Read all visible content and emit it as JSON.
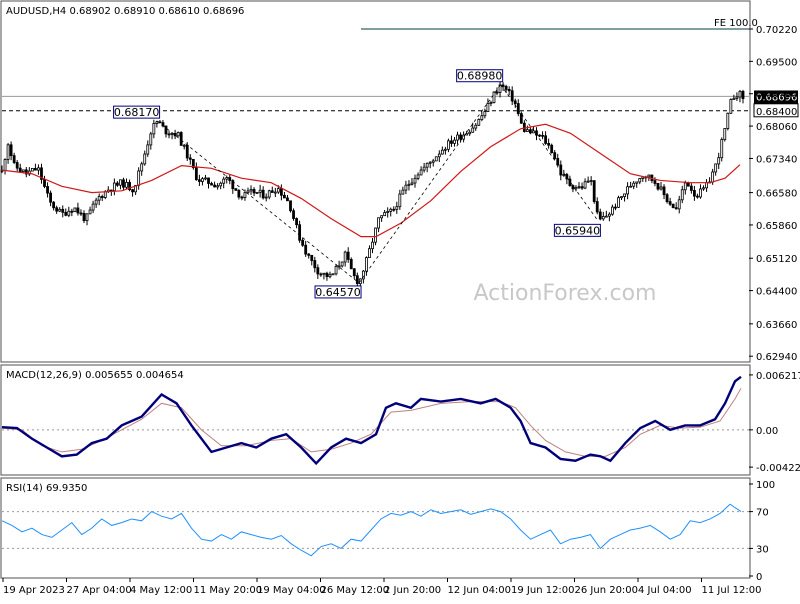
{
  "watermark": "ActionForex.com",
  "colors": {
    "candle": "#000000",
    "ma": "#d01818",
    "macd": "#00007a",
    "signal": "#c08080",
    "rsi": "#1e90ff",
    "annotation_border": "#000080",
    "current_price_box": "#000000",
    "fe_line": "#003c3c",
    "panel_border": "#505050"
  },
  "chart_data": [
    {
      "type": "candlestick",
      "title": "AUDUSD,H4  0.68902 0.68910 0.68610 0.68696",
      "y_ticks": [
        "0.70220",
        "0.69500",
        "0.68780",
        "0.68060",
        "0.67340",
        "0.66580",
        "0.65860",
        "0.65120",
        "0.64400",
        "0.63660",
        "0.62940"
      ],
      "x_ticks": [
        "19 Apr 2023",
        "27 Apr 04:00",
        "4 May 12:00",
        "11 May 20:00",
        "19 May 04:00",
        "26 May 12:00",
        "2 Jun 20:00",
        "12 Jun 04:00",
        "19 Jun 12:00",
        "26 Jun 20:00",
        "4 Jul 04:00",
        "11 Jul 12:00"
      ],
      "ylim": [
        0.629,
        0.7042
      ],
      "path_points": [
        [
          0,
          0.6705
        ],
        [
          6,
          0.677
        ],
        [
          12,
          0.6718
        ],
        [
          24,
          0.67
        ],
        [
          36,
          0.6712
        ],
        [
          48,
          0.6636
        ],
        [
          60,
          0.661
        ],
        [
          72,
          0.6625
        ],
        [
          84,
          0.6598
        ],
        [
          96,
          0.6645
        ],
        [
          108,
          0.6668
        ],
        [
          120,
          0.668
        ],
        [
          132,
          0.6665
        ],
        [
          144,
          0.6752
        ],
        [
          150,
          0.68
        ],
        [
          156,
          0.6817
        ],
        [
          164,
          0.6795
        ],
        [
          176,
          0.6788
        ],
        [
          186,
          0.674
        ],
        [
          196,
          0.6688
        ],
        [
          206,
          0.6682
        ],
        [
          216,
          0.6675
        ],
        [
          226,
          0.669
        ],
        [
          240,
          0.6648
        ],
        [
          252,
          0.666
        ],
        [
          264,
          0.6652
        ],
        [
          276,
          0.667
        ],
        [
          288,
          0.6635
        ],
        [
          298,
          0.656
        ],
        [
          306,
          0.652
        ],
        [
          318,
          0.648
        ],
        [
          330,
          0.647
        ],
        [
          344,
          0.652
        ],
        [
          352,
          0.6475
        ],
        [
          358,
          0.6457
        ],
        [
          366,
          0.651
        ],
        [
          378,
          0.66
        ],
        [
          392,
          0.6618
        ],
        [
          404,
          0.6668
        ],
        [
          416,
          0.67
        ],
        [
          428,
          0.6722
        ],
        [
          440,
          0.6752
        ],
        [
          452,
          0.6775
        ],
        [
          464,
          0.679
        ],
        [
          476,
          0.6812
        ],
        [
          486,
          0.6845
        ],
        [
          494,
          0.688
        ],
        [
          500,
          0.6898
        ],
        [
          506,
          0.6885
        ],
        [
          514,
          0.686
        ],
        [
          522,
          0.68
        ],
        [
          532,
          0.679
        ],
        [
          542,
          0.678
        ],
        [
          552,
          0.675
        ],
        [
          560,
          0.6702
        ],
        [
          570,
          0.6675
        ],
        [
          580,
          0.6668
        ],
        [
          590,
          0.669
        ],
        [
          598,
          0.6594
        ],
        [
          608,
          0.661
        ],
        [
          620,
          0.6645
        ],
        [
          632,
          0.668
        ],
        [
          644,
          0.67
        ],
        [
          656,
          0.668
        ],
        [
          666,
          0.6645
        ],
        [
          676,
          0.662
        ],
        [
          686,
          0.6685
        ],
        [
          696,
          0.665
        ],
        [
          706,
          0.667
        ],
        [
          716,
          0.672
        ],
        [
          724,
          0.679
        ],
        [
          732,
          0.687
        ],
        [
          738,
          0.688
        ],
        [
          743,
          0.68696
        ]
      ],
      "ma_points": [
        [
          0,
          0.6708
        ],
        [
          30,
          0.67
        ],
        [
          60,
          0.6672
        ],
        [
          90,
          0.6658
        ],
        [
          120,
          0.6662
        ],
        [
          150,
          0.6685
        ],
        [
          180,
          0.6718
        ],
        [
          210,
          0.6712
        ],
        [
          240,
          0.669
        ],
        [
          270,
          0.668
        ],
        [
          300,
          0.6645
        ],
        [
          330,
          0.66
        ],
        [
          360,
          0.656
        ],
        [
          375,
          0.656
        ],
        [
          400,
          0.659
        ],
        [
          430,
          0.664
        ],
        [
          460,
          0.6705
        ],
        [
          490,
          0.676
        ],
        [
          520,
          0.68
        ],
        [
          545,
          0.681
        ],
        [
          570,
          0.679
        ],
        [
          600,
          0.6745
        ],
        [
          630,
          0.67
        ],
        [
          660,
          0.6685
        ],
        [
          690,
          0.668
        ],
        [
          710,
          0.668
        ],
        [
          725,
          0.669
        ],
        [
          740,
          0.672
        ]
      ],
      "annotations": [
        {
          "label": "0.68170",
          "x": 156,
          "y": 0.6817
        },
        {
          "label": "0.64570",
          "x": 358,
          "y": 0.6457
        },
        {
          "label": "0.68980",
          "x": 500,
          "y": 0.6898
        },
        {
          "label": "0.65940",
          "x": 598,
          "y": 0.6594
        }
      ],
      "fe_label": "FE 100.0",
      "fe_level": 0.7022,
      "dashed_level": 0.684,
      "dashed_label": "0.68400",
      "current_price_label": "0.68696",
      "current_price": 0.68696,
      "horizontal_line_level": 0.6872
    },
    {
      "type": "line",
      "title": "MACD(12,26,9) 0.005655 0.004654",
      "y_ticks": [
        "0.006217",
        "0.00",
        "-0.004221"
      ],
      "ylim": [
        -0.005,
        0.007
      ],
      "series": [
        {
          "values": [
            [
              0,
              0.0003
            ],
            [
              15,
              0.0002
            ],
            [
              30,
              -0.001
            ],
            [
              45,
              -0.002
            ],
            [
              60,
              -0.003
            ],
            [
              75,
              -0.0028
            ],
            [
              90,
              -0.0015
            ],
            [
              105,
              -0.001
            ],
            [
              120,
              0.0005
            ],
            [
              140,
              0.0015
            ],
            [
              160,
              0.004
            ],
            [
              175,
              0.003
            ],
            [
              190,
              0.0005
            ],
            [
              200,
              -0.001
            ],
            [
              210,
              -0.0025
            ],
            [
              225,
              -0.002
            ],
            [
              240,
              -0.0015
            ],
            [
              255,
              -0.002
            ],
            [
              270,
              -0.001
            ],
            [
              285,
              -0.0005
            ],
            [
              300,
              -0.002
            ],
            [
              315,
              -0.0038
            ],
            [
              330,
              -0.002
            ],
            [
              345,
              -0.001
            ],
            [
              360,
              -0.0015
            ],
            [
              375,
              -0.0005
            ],
            [
              385,
              0.0025
            ],
            [
              395,
              0.003
            ],
            [
              410,
              0.0025
            ],
            [
              420,
              0.0035
            ],
            [
              440,
              0.0032
            ],
            [
              460,
              0.0035
            ],
            [
              480,
              0.003
            ],
            [
              495,
              0.0035
            ],
            [
              510,
              0.0025
            ],
            [
              520,
              0.001
            ],
            [
              530,
              -0.0015
            ],
            [
              545,
              -0.002
            ],
            [
              560,
              -0.0033
            ],
            [
              575,
              -0.0035
            ],
            [
              590,
              -0.0028
            ],
            [
              600,
              -0.003
            ],
            [
              610,
              -0.0035
            ],
            [
              625,
              -0.0015
            ],
            [
              640,
              0.0002
            ],
            [
              655,
              0.001
            ],
            [
              670,
              0.0
            ],
            [
              685,
              0.0005
            ],
            [
              700,
              0.0005
            ],
            [
              715,
              0.0012
            ],
            [
              725,
              0.003
            ],
            [
              735,
              0.0055
            ],
            [
              741,
              0.006
            ]
          ]
        },
        {
          "values": [
            [
              0,
              0.0002
            ],
            [
              20,
              0.0
            ],
            [
              40,
              -0.0018
            ],
            [
              60,
              -0.0025
            ],
            [
              80,
              -0.0022
            ],
            [
              100,
              -0.0012
            ],
            [
              120,
              0.0
            ],
            [
              140,
              0.0012
            ],
            [
              160,
              0.003
            ],
            [
              180,
              0.0025
            ],
            [
              200,
              0.0
            ],
            [
              220,
              -0.0018
            ],
            [
              245,
              -0.0018
            ],
            [
              270,
              -0.0012
            ],
            [
              290,
              -0.001
            ],
            [
              310,
              -0.0025
            ],
            [
              330,
              -0.0022
            ],
            [
              350,
              -0.0015
            ],
            [
              370,
              -0.0005
            ],
            [
              390,
              0.002
            ],
            [
              410,
              0.0022
            ],
            [
              440,
              0.003
            ],
            [
              470,
              0.0032
            ],
            [
              500,
              0.0032
            ],
            [
              515,
              0.0025
            ],
            [
              530,
              0.0005
            ],
            [
              545,
              -0.0012
            ],
            [
              565,
              -0.0025
            ],
            [
              585,
              -0.003
            ],
            [
              605,
              -0.003
            ],
            [
              625,
              -0.002
            ],
            [
              640,
              -0.0005
            ],
            [
              660,
              0.0005
            ],
            [
              680,
              0.0002
            ],
            [
              700,
              0.0003
            ],
            [
              720,
              0.001
            ],
            [
              735,
              0.0035
            ],
            [
              741,
              0.0047
            ]
          ]
        }
      ],
      "zero_level": 0.0
    },
    {
      "type": "line",
      "title": "RSI(14) 69.9350",
      "y_ticks": [
        "100",
        "70",
        "30",
        "0"
      ],
      "ylim": [
        0,
        100
      ],
      "levels": [
        70,
        30
      ],
      "series": [
        {
          "values": [
            [
              0,
              60
            ],
            [
              10,
              55
            ],
            [
              20,
              48
            ],
            [
              30,
              52
            ],
            [
              40,
              45
            ],
            [
              50,
              42
            ],
            [
              60,
              50
            ],
            [
              70,
              58
            ],
            [
              80,
              45
            ],
            [
              90,
              52
            ],
            [
              100,
              62
            ],
            [
              110,
              55
            ],
            [
              120,
              58
            ],
            [
              130,
              62
            ],
            [
              140,
              60
            ],
            [
              150,
              70
            ],
            [
              160,
              65
            ],
            [
              170,
              62
            ],
            [
              180,
              68
            ],
            [
              190,
              52
            ],
            [
              200,
              40
            ],
            [
              210,
              38
            ],
            [
              220,
              45
            ],
            [
              230,
              40
            ],
            [
              240,
              48
            ],
            [
              250,
              45
            ],
            [
              260,
              42
            ],
            [
              270,
              40
            ],
            [
              280,
              44
            ],
            [
              290,
              35
            ],
            [
              300,
              28
            ],
            [
              310,
              22
            ],
            [
              320,
              32
            ],
            [
              330,
              35
            ],
            [
              340,
              30
            ],
            [
              350,
              40
            ],
            [
              360,
              38
            ],
            [
              370,
              50
            ],
            [
              380,
              62
            ],
            [
              390,
              68
            ],
            [
              400,
              66
            ],
            [
              410,
              70
            ],
            [
              420,
              65
            ],
            [
              430,
              72
            ],
            [
              440,
              68
            ],
            [
              450,
              70
            ],
            [
              460,
              72
            ],
            [
              470,
              67
            ],
            [
              480,
              70
            ],
            [
              490,
              73
            ],
            [
              500,
              70
            ],
            [
              510,
              62
            ],
            [
              520,
              50
            ],
            [
              530,
              40
            ],
            [
              540,
              45
            ],
            [
              550,
              50
            ],
            [
              560,
              35
            ],
            [
              570,
              40
            ],
            [
              580,
              42
            ],
            [
              590,
              45
            ],
            [
              600,
              30
            ],
            [
              610,
              40
            ],
            [
              620,
              45
            ],
            [
              630,
              50
            ],
            [
              640,
              52
            ],
            [
              650,
              55
            ],
            [
              660,
              48
            ],
            [
              670,
              40
            ],
            [
              680,
              45
            ],
            [
              690,
              60
            ],
            [
              700,
              58
            ],
            [
              710,
              62
            ],
            [
              720,
              68
            ],
            [
              730,
              78
            ],
            [
              741,
              70
            ]
          ]
        }
      ]
    }
  ]
}
